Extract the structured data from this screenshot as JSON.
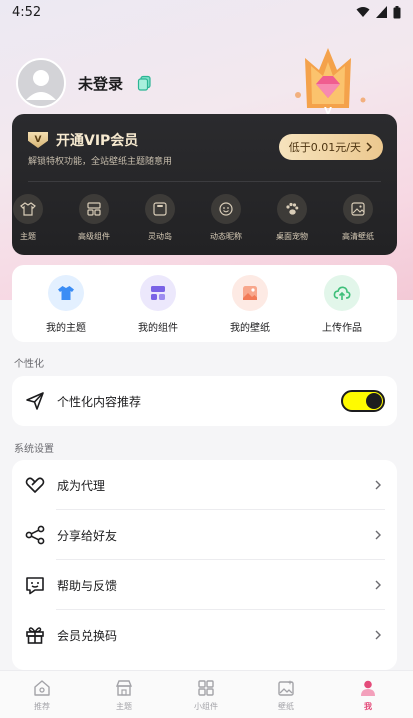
{
  "status_bar": {
    "time": "4:52"
  },
  "profile": {
    "name": "未登录"
  },
  "vip": {
    "title": "开通VIP会员",
    "subtitle": "解锁特权功能，全站壁纸主题随意用",
    "price_label": "低于0.01元/天",
    "features": [
      {
        "label": "主题",
        "icon": "shirt-icon"
      },
      {
        "label": "高级组件",
        "icon": "widget-icon"
      },
      {
        "label": "灵动岛",
        "icon": "island-icon"
      },
      {
        "label": "动态昵称",
        "icon": "smile-icon"
      },
      {
        "label": "桌面宠物",
        "icon": "paw-icon"
      },
      {
        "label": "高清壁纸",
        "icon": "image-icon"
      }
    ]
  },
  "quick_actions": [
    {
      "label": "我的主题",
      "icon": "shirt-icon",
      "color": "#3b8df5",
      "bg": "#e3f0ff"
    },
    {
      "label": "我的组件",
      "icon": "widget-icon",
      "color": "#7a63e6",
      "bg": "#ece8fc"
    },
    {
      "label": "我的壁纸",
      "icon": "image-icon",
      "color": "#f27a56",
      "bg": "#fdeae4"
    },
    {
      "label": "上传作品",
      "icon": "cloud-upload-icon",
      "color": "#3fbf7a",
      "bg": "#e2f6ea"
    }
  ],
  "personalization": {
    "section_title": "个性化",
    "row_label": "个性化内容推荐",
    "toggle_on": true
  },
  "system": {
    "section_title": "系统设置",
    "rows": [
      {
        "label": "成为代理",
        "icon": "handshake-icon"
      },
      {
        "label": "分享给好友",
        "icon": "share-icon"
      },
      {
        "label": "帮助与反馈",
        "icon": "feedback-icon"
      },
      {
        "label": "会员兑换码",
        "icon": "gift-icon"
      }
    ]
  },
  "tabs": [
    {
      "label": "推荐",
      "icon": "home-icon",
      "active": false
    },
    {
      "label": "主题",
      "icon": "shop-icon",
      "active": false
    },
    {
      "label": "小组件",
      "icon": "widget-icon",
      "active": false
    },
    {
      "label": "壁纸",
      "icon": "image-sparkle-icon",
      "active": false
    },
    {
      "label": "我",
      "icon": "person-icon",
      "active": true
    }
  ],
  "colors": {
    "accent": "#e44b7a",
    "toggle": "#fffb00",
    "vip_gold": "#f2e3c6"
  }
}
